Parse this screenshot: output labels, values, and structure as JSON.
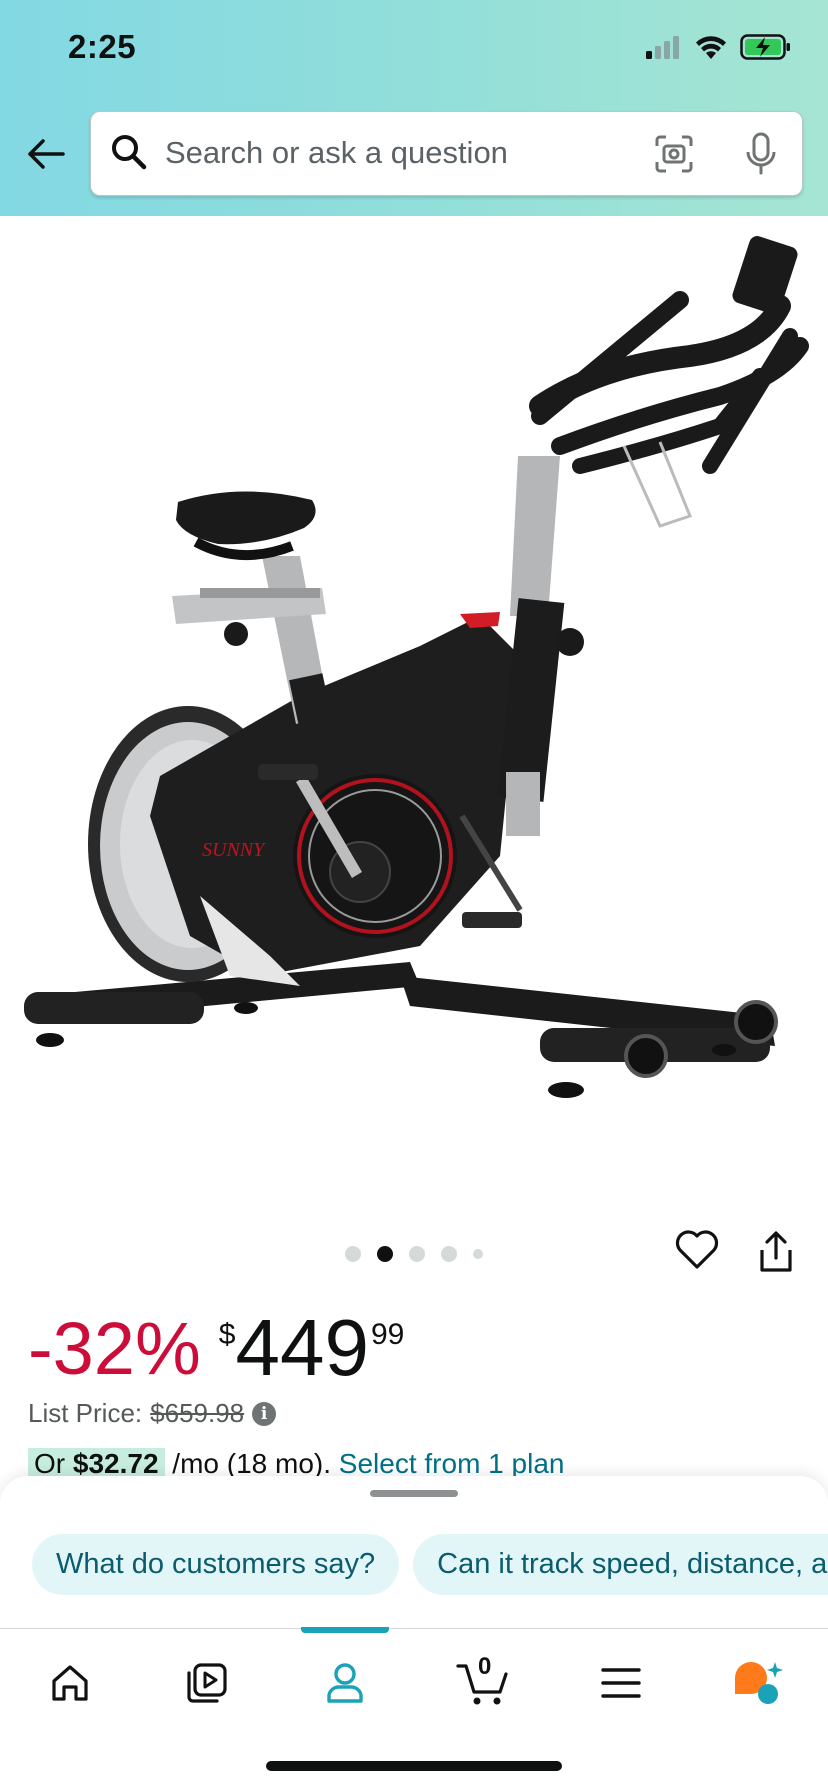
{
  "status_bar": {
    "time": "2:25"
  },
  "search": {
    "placeholder": "Search or ask a question"
  },
  "product": {
    "image_alt": "Stationary exercise bike",
    "gallery": {
      "count": 5,
      "active_index": 1
    }
  },
  "price": {
    "discount": "-32%",
    "currency": "$",
    "whole": "449",
    "fraction": "99",
    "list_price_label": "List Price:",
    "list_price_value": "$659.98",
    "plan_prefix": "Or ",
    "plan_amount": "$32.72",
    "plan_terms": " /mo (18 mo). ",
    "plan_link": "Select from 1 plan"
  },
  "assistant_chips": [
    {
      "label": "What do customers say?"
    },
    {
      "label": "Can it track speed, distance, and calories?"
    }
  ],
  "nav": {
    "cart_count": "0",
    "active": "account"
  },
  "colors": {
    "discount": "#cc0c39",
    "link": "#007185",
    "accent": "#1aa3b8"
  }
}
